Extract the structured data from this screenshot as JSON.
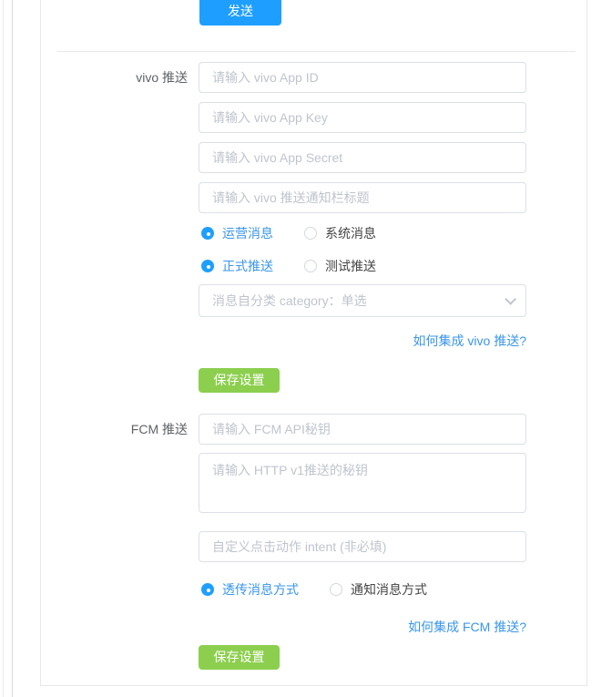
{
  "colors": {
    "primary_blue": "#1e9fff",
    "link_blue": "#3a96e9",
    "success_green": "#8ccf4e",
    "input_border": "#dcdfe6",
    "placeholder_gray": "#bfc4cd"
  },
  "send_section": {
    "send_label": "发送"
  },
  "vivo": {
    "label": "vivo 推送",
    "inputs": [
      {
        "placeholder": "请输入 vivo App ID",
        "value": ""
      },
      {
        "placeholder": "请输入 vivo App Key",
        "value": ""
      },
      {
        "placeholder": "请输入 vivo App Secret",
        "value": ""
      },
      {
        "placeholder": "请输入 vivo 推送通知栏标题",
        "value": ""
      }
    ],
    "message_type_group": {
      "options": [
        {
          "label": "运营消息",
          "checked": true
        },
        {
          "label": "系统消息",
          "checked": false
        }
      ]
    },
    "push_mode_group": {
      "options": [
        {
          "label": "正式推送",
          "checked": true
        },
        {
          "label": "测试推送",
          "checked": false
        }
      ]
    },
    "category_select": {
      "placeholder": "消息自分类 category：单选",
      "selected_value": ""
    },
    "help_link": "如何集成 vivo 推送?",
    "save_label": "保存设置"
  },
  "fcm": {
    "label": "FCM 推送",
    "api_key_input": {
      "placeholder": "请输入 FCM API秘钥",
      "value": ""
    },
    "http_v1_textarea": {
      "placeholder": "请输入 HTTP v1推送的秘钥",
      "value": ""
    },
    "intent_input": {
      "placeholder": "自定义点击动作 intent (非必填)",
      "value": ""
    },
    "delivery_mode_group": {
      "options": [
        {
          "label": "透传消息方式",
          "checked": true
        },
        {
          "label": "通知消息方式",
          "checked": false
        }
      ]
    },
    "help_link": "如何集成 FCM 推送?",
    "save_label": "保存设置"
  }
}
